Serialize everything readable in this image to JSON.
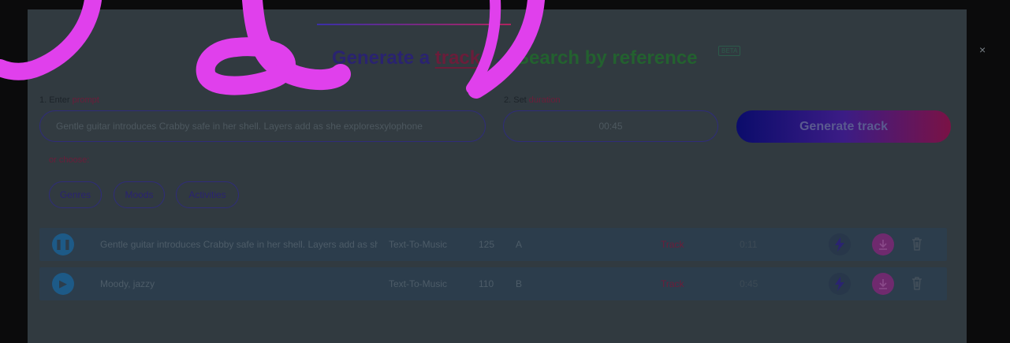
{
  "header": {
    "tab_generate_prefix": "Generate a ",
    "tab_generate_highlight": "track",
    "tab_search": "Search by reference",
    "beta_label": "BETA",
    "close_glyph": "×"
  },
  "form": {
    "step1_number": "1. Enter ",
    "step1_word": "prompt",
    "step2_number": "2. Set ",
    "step2_word": "duration",
    "prompt_value": "Gentle guitar introduces Crabby safe in her shell. Layers add as she exploresxylophone",
    "duration_value": "00:45",
    "generate_label": "Generate track",
    "or_choose": "or choose:"
  },
  "chips": [
    {
      "label": "Genres"
    },
    {
      "label": "Moods"
    },
    {
      "label": "Activities"
    }
  ],
  "tracks": [
    {
      "state": "playing",
      "description": "Gentle guitar introduces Crabby safe in her shell. Layers add as she explores",
      "type": "Text-To-Music",
      "bpm": "125",
      "key": "A",
      "kind": "Track",
      "duration": "0:11"
    },
    {
      "state": "paused",
      "description": "Moody, jazzy",
      "type": "Text-To-Music",
      "bpm": "110",
      "key": "B",
      "kind": "Track",
      "duration": "0:45"
    }
  ],
  "icons": {
    "play_pause": "pause-icon",
    "play": "play-icon",
    "bolt": "lightning-icon",
    "download": "download-icon",
    "trash": "trash-icon",
    "chevron": "chevron-down-icon"
  },
  "colors": {
    "generate_accent": "#6b1d3a",
    "search_accent": "#23612f",
    "download_bg": "#6f2a6e",
    "scribble": "#e040ec"
  }
}
